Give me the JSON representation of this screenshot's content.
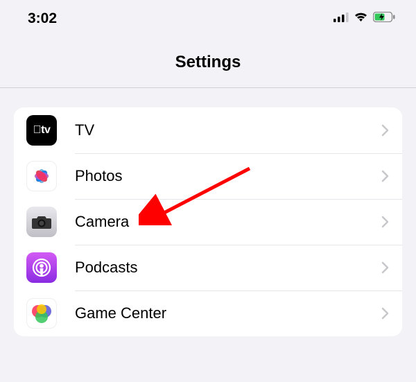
{
  "status_bar": {
    "time": "3:02",
    "cellular": "cellular-icon",
    "wifi": "wifi-icon",
    "battery": "battery-icon"
  },
  "header": {
    "title": "Settings"
  },
  "rows": [
    {
      "icon": "tv-icon",
      "label": "TV"
    },
    {
      "icon": "photos-icon",
      "label": "Photos"
    },
    {
      "icon": "camera-icon",
      "label": "Camera"
    },
    {
      "icon": "podcasts-icon",
      "label": "Podcasts"
    },
    {
      "icon": "game-center-icon",
      "label": "Game Center"
    }
  ],
  "annotation": {
    "arrow_color": "#ff0000",
    "target_row": "camera"
  }
}
